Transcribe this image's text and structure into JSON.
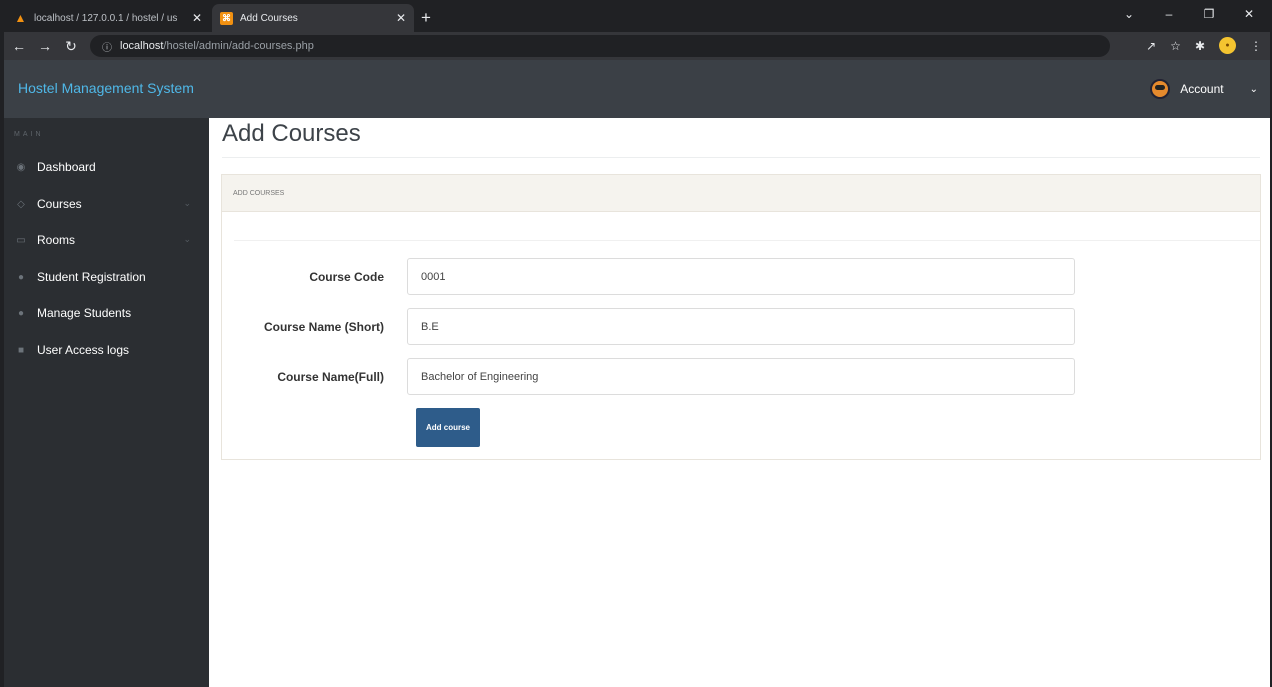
{
  "browser": {
    "tabs": [
      {
        "title": "localhost / 127.0.0.1 / hostel / us",
        "favicon": "phpmyadmin-icon",
        "active": false
      },
      {
        "title": "Add Courses",
        "favicon": "xampp-icon",
        "active": true
      }
    ],
    "url_host": "localhost",
    "url_path": "/hostel/admin/add-courses.php"
  },
  "header": {
    "brand": "Hostel Management System",
    "account_label": "Account"
  },
  "sidebar": {
    "section_label": "MAIN",
    "items": [
      {
        "label": "Dashboard",
        "icon": "dashboard-icon",
        "has_submenu": false
      },
      {
        "label": "Courses",
        "icon": "courses-icon",
        "has_submenu": true
      },
      {
        "label": "Rooms",
        "icon": "rooms-icon",
        "has_submenu": true
      },
      {
        "label": "Student Registration",
        "icon": "user-icon",
        "has_submenu": false
      },
      {
        "label": "Manage Students",
        "icon": "users-icon",
        "has_submenu": false
      },
      {
        "label": "User Access logs",
        "icon": "file-icon",
        "has_submenu": false
      }
    ]
  },
  "main": {
    "page_title": "Add Courses",
    "panel_title": "ADD COURSES",
    "form": {
      "fields": [
        {
          "label": "Course Code",
          "value": "0001"
        },
        {
          "label": "Course Name (Short)",
          "value": "B.E"
        },
        {
          "label": "Course Name(Full)",
          "value": "Bachelor of Engineering"
        }
      ],
      "submit_label": "Add course"
    }
  },
  "colors": {
    "header_bg": "#3b4046",
    "sidebar_bg": "#2b2e32",
    "brand_text": "#4fb8e8",
    "button_bg": "#2e5c8a"
  }
}
